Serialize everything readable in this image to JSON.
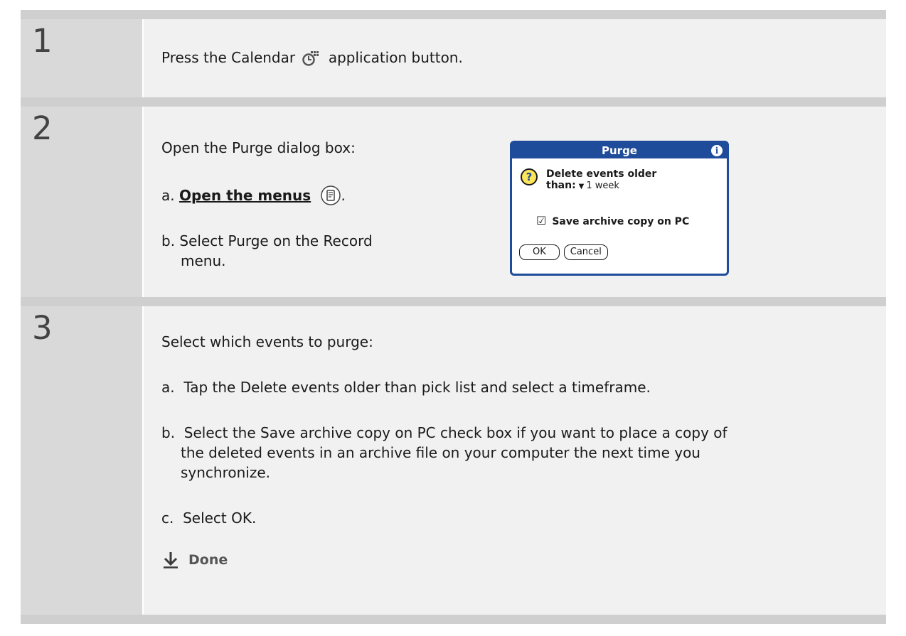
{
  "steps": [
    {
      "number": "1",
      "text_before": "Press the Calendar",
      "icon": "calendar-app-icon",
      "text_after": "application button."
    },
    {
      "number": "2",
      "heading": "Open the Purge dialog box:",
      "a_prefix": "a.",
      "a_link": "Open the menus",
      "a_icon": "menu-button-icon",
      "a_suffix": ".",
      "b_prefix": "b.",
      "b_text_line1": "Select Purge on the Record",
      "b_text_line2": "menu."
    },
    {
      "number": "3",
      "heading": "Select which events to purge:",
      "a_text": "a.  Tap the Delete events older than pick list and select a timeframe.",
      "b_line1": "b.  Select the Save archive copy on PC check box if you want to place a copy of",
      "b_line2": "the deleted events in an archive file on your computer the next time you",
      "b_line3": "synchronize.",
      "c_text": "c.  Select OK.",
      "done_label": "Done",
      "done_icon": "down-arrow-icon"
    }
  ],
  "dialog": {
    "title": "Purge",
    "info_icon": "info-icon",
    "question_icon": "question-icon",
    "message_line1": "Delete events older",
    "message_line2_label": "than:",
    "picklist_arrow": "▼",
    "picklist_value": "1 week",
    "checkbox_label": "Save archive copy on PC",
    "ok_label": "OK",
    "cancel_label": "Cancel",
    "accent_color": "#1f4c9a"
  }
}
